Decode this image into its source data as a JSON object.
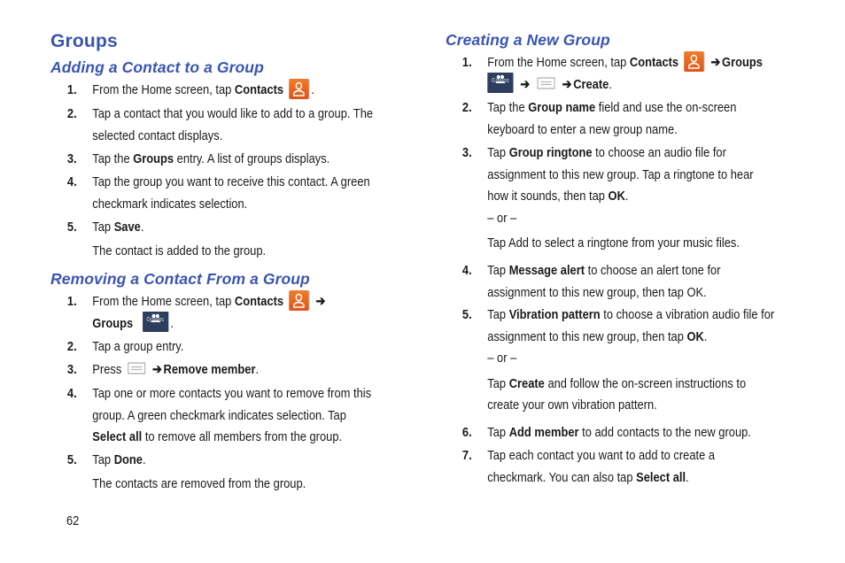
{
  "title": "Groups",
  "page_number": "62",
  "arrow": "➔",
  "or_separator": "– or –",
  "sections": {
    "adding": {
      "heading": "Adding a Contact to a Group",
      "steps": [
        {
          "num": "1.",
          "pre": "From the Home screen, tap ",
          "bold": "Contacts",
          "post": "."
        },
        {
          "num": "2.",
          "line1": "Tap a contact that you would like to add to a group. The",
          "line2": "selected contact displays."
        },
        {
          "num": "3.",
          "pre": "Tap the ",
          "bold": "Groups",
          "post": " entry. A list of groups displays."
        },
        {
          "num": "4.",
          "line1": "Tap the group you want to receive this contact. A green",
          "line2": "checkmark indicates selection."
        },
        {
          "num": "5.",
          "pre": "Tap ",
          "bold": "Save",
          "post": ".",
          "note": "The contact is added to the group."
        }
      ]
    },
    "removing": {
      "heading": "Removing a Contact From a Group",
      "steps": [
        {
          "num": "1.",
          "pre": "From the Home screen, tap ",
          "bold": "Contacts",
          "bold2": "Groups",
          "post": "."
        },
        {
          "num": "2.",
          "text": "Tap a group entry."
        },
        {
          "num": "3.",
          "pre": "Press ",
          "bold": "Remove member",
          "post": "."
        },
        {
          "num": "4.",
          "line1": "Tap one or more contacts you want to remove from this",
          "line2": "group. A green checkmark indicates selection. Tap",
          "bold": "Select all",
          "line3": " to remove all members from the group."
        },
        {
          "num": "5.",
          "pre": "Tap ",
          "bold": "Done",
          "post": ".",
          "note": "The contacts are removed from the group."
        }
      ]
    },
    "creating": {
      "heading": "Creating a New Group",
      "steps": [
        {
          "num": "1.",
          "pre": "From the Home screen, tap ",
          "bold": "Contacts",
          "bold2": "Groups",
          "bold3": "Create",
          "post": "."
        },
        {
          "num": "2.",
          "pre": "Tap the ",
          "bold": "Group name",
          "post": " field and use the on-screen",
          "line2": "keyboard to enter a new group name."
        },
        {
          "num": "3.",
          "pre": "Tap ",
          "bold": "Group ringtone",
          "post": " to choose an audio file for",
          "line2": "assignment to this new group. Tap a ringtone to hear",
          "line3pre": "how it sounds, then tap ",
          "bold2": "OK",
          "line3post": ".",
          "alt": "Tap Add to select a ringtone from your music files."
        },
        {
          "num": "4.",
          "pre": "Tap ",
          "bold": "Message alert",
          "post": " to choose an alert tone for",
          "line2": "assignment to this new group, then tap OK."
        },
        {
          "num": "5.",
          "pre": "Tap ",
          "bold": "Vibration pattern",
          "post": " to choose a vibration audio file for",
          "line2pre": "assignment to this new group, then tap ",
          "bold2": "OK",
          "line2post": ".",
          "altpre": "Tap ",
          "altbold": "Create",
          "altpost": " and follow the on-screen instructions to",
          "altline2": "create your own vibration pattern."
        },
        {
          "num": "6.",
          "pre": "Tap ",
          "bold": "Add member",
          "post": " to add contacts to the new group."
        },
        {
          "num": "7.",
          "line1": "Tap each contact you want to add to create a",
          "line2pre": "checkmark. You can also tap ",
          "bold": "Select all",
          "line2post": "."
        }
      ]
    }
  },
  "icons": {
    "contacts_color": "#e8612a",
    "groups_color": "#2d3e5e",
    "groups_label": "Groups"
  }
}
